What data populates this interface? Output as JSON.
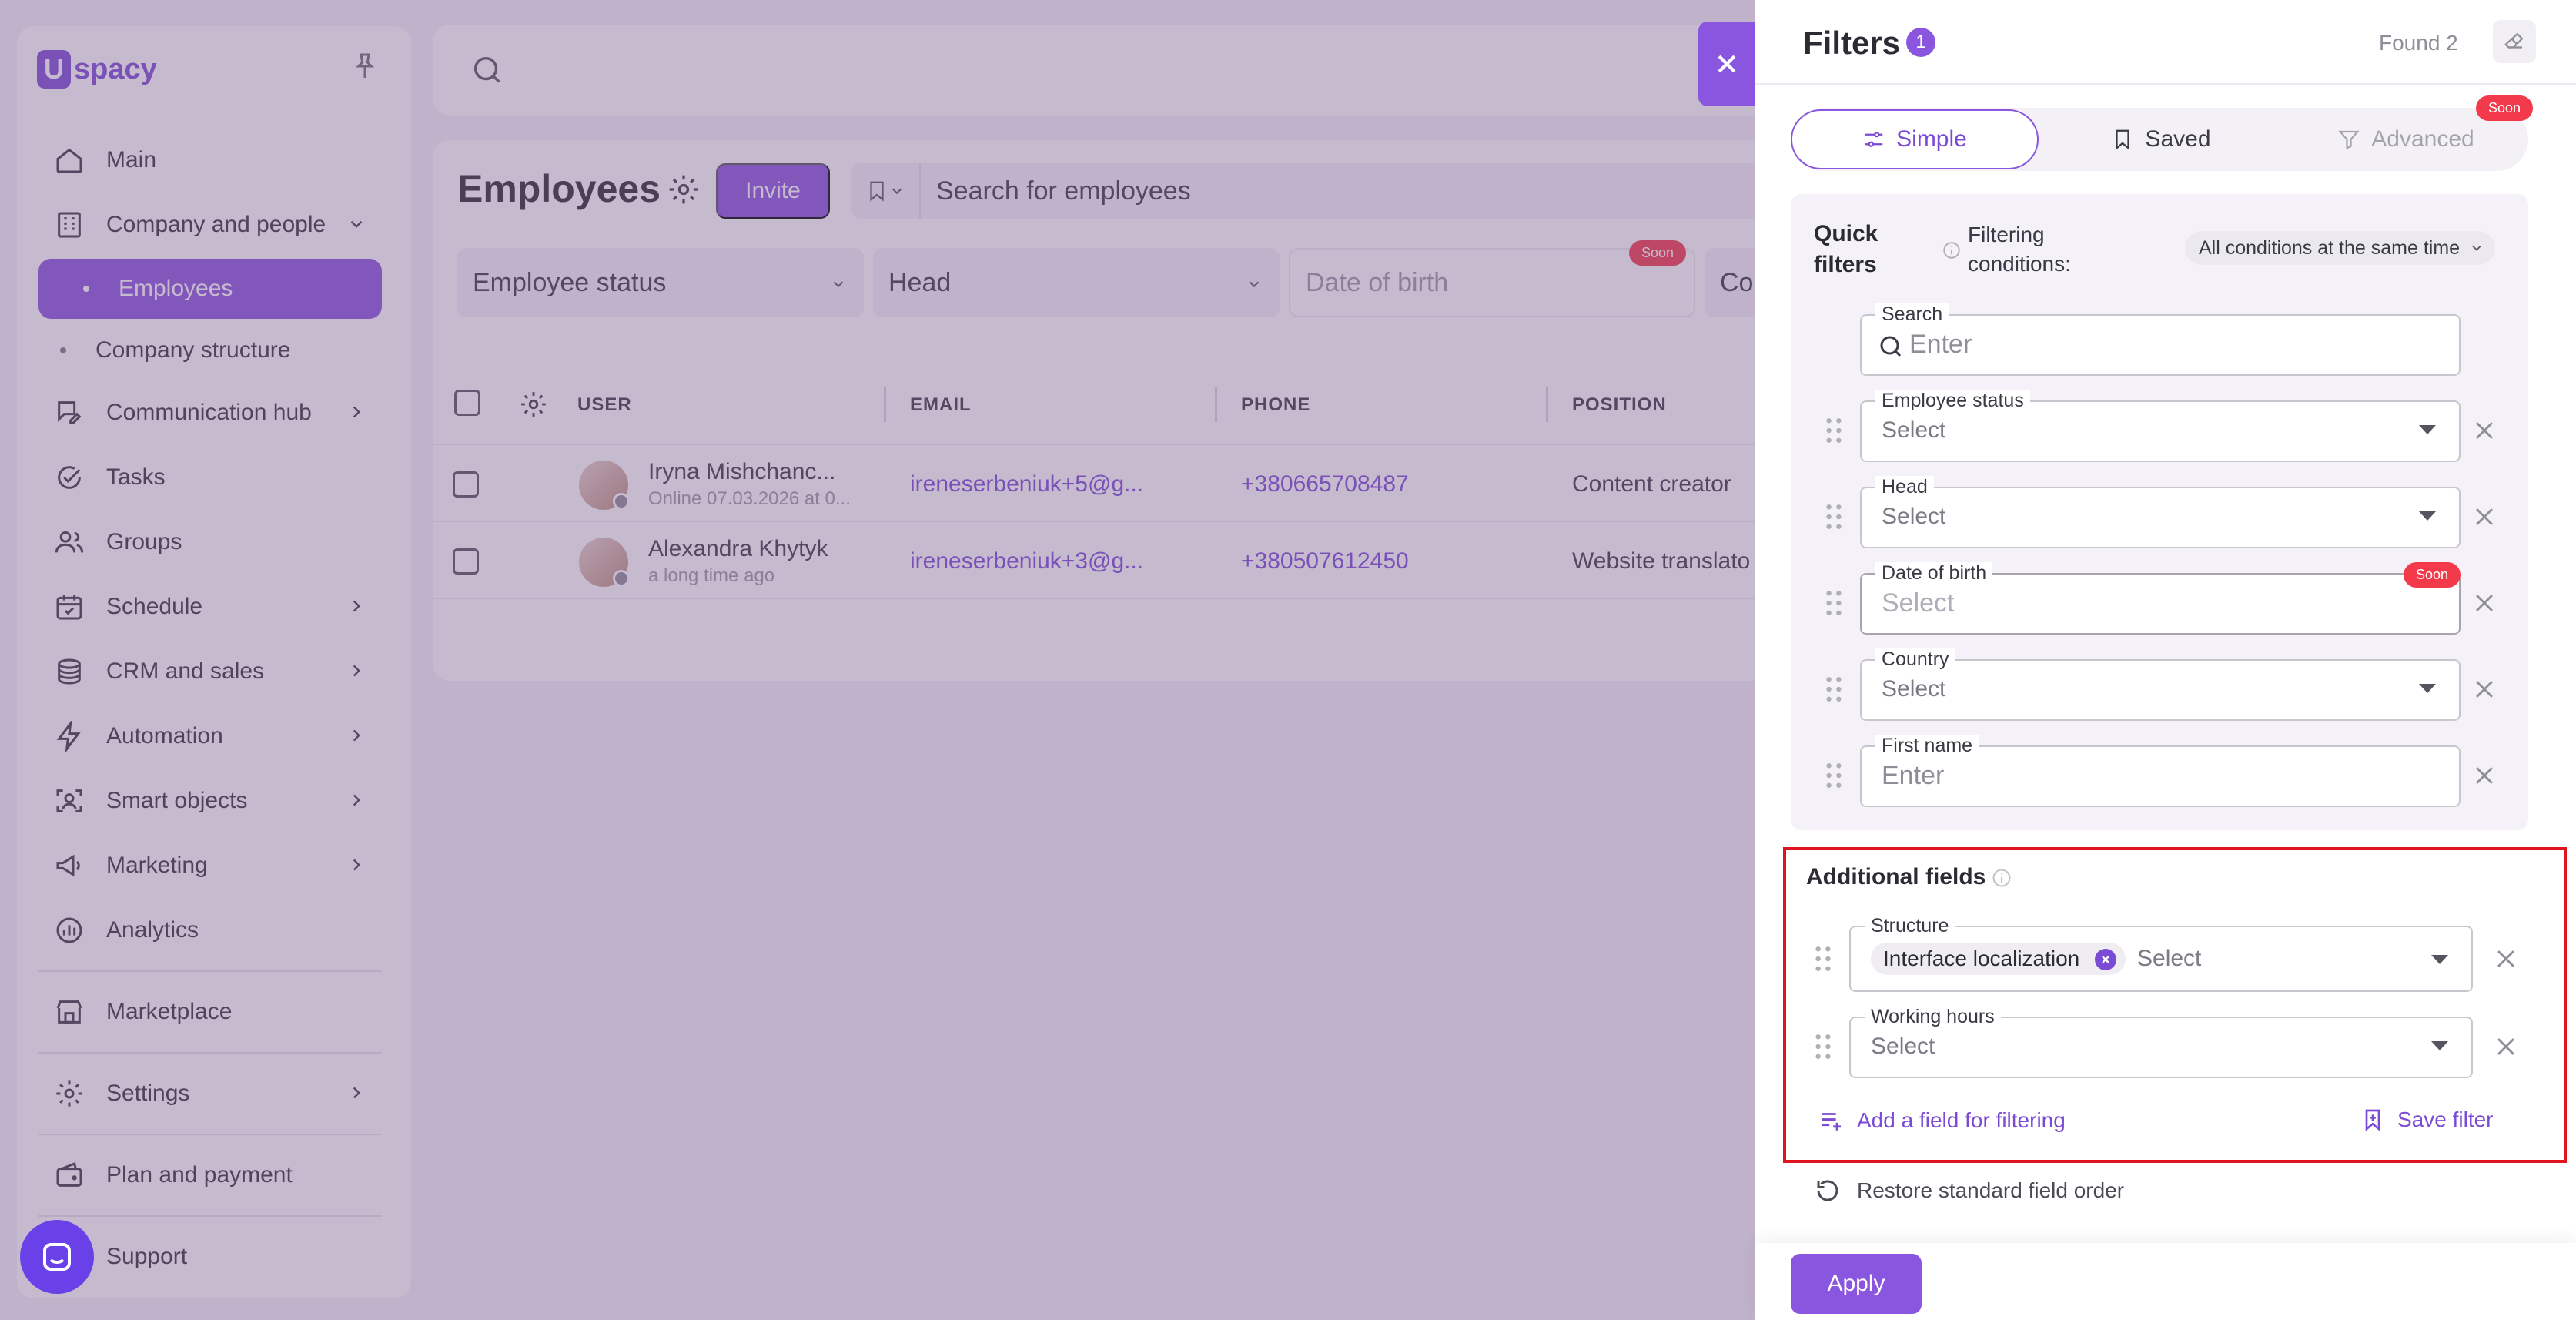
{
  "app": {
    "logo_text": "spacy",
    "logo_mark": "U",
    "nav": {
      "main": "Main",
      "company": "Company and people",
      "employees": "Employees",
      "company_structure": "Company structure",
      "communication": "Communication hub",
      "tasks": "Tasks",
      "groups": "Groups",
      "schedule": "Schedule",
      "crm": "CRM and sales",
      "automation": "Automation",
      "smart": "Smart objects",
      "marketing": "Marketing",
      "analytics": "Analytics",
      "marketplace": "Marketplace",
      "settings": "Settings",
      "plan": "Plan and payment",
      "support": "Support"
    }
  },
  "employees": {
    "title": "Employees",
    "invite_label": "Invite",
    "search_placeholder": "Search for employees",
    "quick_filters": {
      "status": "Employee status",
      "head": "Head",
      "dob": "Date of birth",
      "dob_badge": "Soon",
      "country": "Cou"
    },
    "columns": {
      "user": "USER",
      "email": "EMAIL",
      "phone": "PHONE",
      "position": "POSITION"
    },
    "rows": [
      {
        "name": "Iryna Mishchanc...",
        "sub": "Online 07.03.2026 at 0...",
        "email": "ireneserbeniuk+5@g...",
        "phone": "+380665708487",
        "position": "Content creator"
      },
      {
        "name": "Alexandra Khytyk",
        "sub": "a long time ago",
        "email": "ireneserbeniuk+3@g...",
        "phone": "+380507612450",
        "position": "Website translato"
      }
    ]
  },
  "filters": {
    "title": "Filters",
    "active_count": "1",
    "found_label": "Found 2",
    "tabs": {
      "simple": "Simple",
      "saved": "Saved",
      "advanced": "Advanced",
      "advanced_badge": "Soon"
    },
    "quick": {
      "title": "Quick filters",
      "conditions_label": "Filtering conditions:",
      "conditions_value": "All conditions at the same time",
      "search_label": "Search",
      "search_placeholder": "Enter",
      "status_label": "Employee status",
      "status_value": "Select",
      "head_label": "Head",
      "head_value": "Select",
      "dob_label": "Date of birth",
      "dob_value": "Select",
      "dob_badge": "Soon",
      "country_label": "Country",
      "country_value": "Select",
      "first_name_label": "First name",
      "first_name_placeholder": "Enter"
    },
    "additional": {
      "title": "Additional fields",
      "structure_label": "Structure",
      "structure_chip": "Interface localization",
      "structure_value": "Select",
      "hours_label": "Working hours",
      "hours_value": "Select",
      "add_field": "Add a field for filtering",
      "save_filter": "Save filter"
    },
    "restore_label": "Restore standard field order",
    "apply_label": "Apply"
  },
  "colors": {
    "accent": "#8a55df",
    "highlight": "#e0141e",
    "badge": "#f23a4b"
  }
}
